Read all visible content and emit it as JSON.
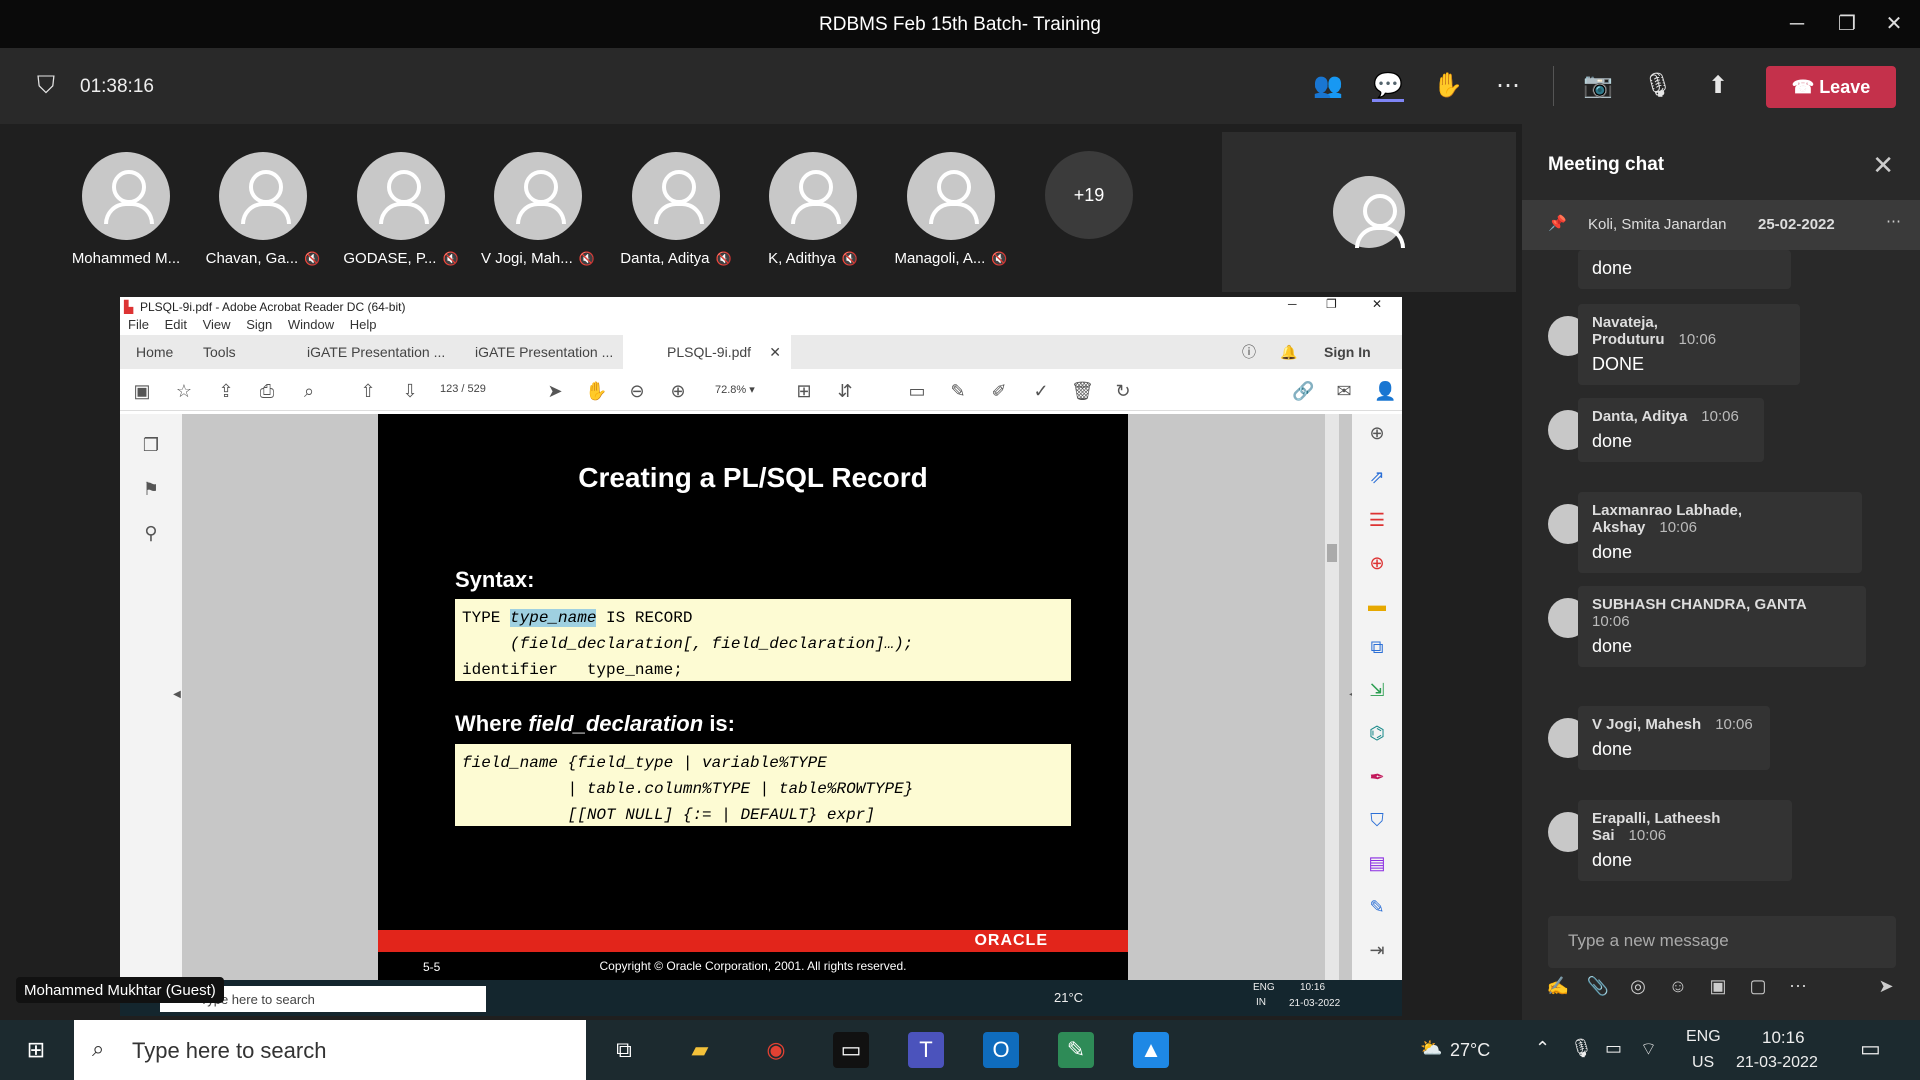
{
  "window": {
    "title": "RDBMS Feb 15th Batch- Training"
  },
  "toolbar": {
    "timer": "01:38:16",
    "leave_label": "Leave"
  },
  "participants": [
    {
      "name": "Mohammed M...",
      "muted": false
    },
    {
      "name": "Chavan, Ga...",
      "muted": true
    },
    {
      "name": "GODASE, P...",
      "muted": true
    },
    {
      "name": "V Jogi, Mah...",
      "muted": true
    },
    {
      "name": "Danta, Aditya",
      "muted": true
    },
    {
      "name": "K, Adithya",
      "muted": true
    },
    {
      "name": "Managoli, A...",
      "muted": true
    }
  ],
  "more_participants": "+19",
  "share": {
    "window_title": "PLSQL-9i.pdf - Adobe Acrobat Reader DC (64-bit)",
    "menu": [
      "File",
      "Edit",
      "View",
      "Sign",
      "Window",
      "Help"
    ],
    "tabs": {
      "home": "Home",
      "tools": "Tools",
      "doc1": "iGATE Presentation ...",
      "doc2": "iGATE Presentation ...",
      "doc3": "PLSQL-9i.pdf"
    },
    "sign_in": "Sign In",
    "page_current": "123",
    "page_total": "/ 529",
    "zoom": "72.8%",
    "slide": {
      "title": "Creating a PL/SQL Record",
      "syntax_heading": "Syntax:",
      "code1_l1a": "TYPE ",
      "code1_l1b": "type_name",
      "code1_l1c": " IS RECORD",
      "code1_l2": "     (field_declaration[, field_declaration]…);",
      "code1_l3": "identifier   type_name;",
      "where_heading_a": "Where ",
      "where_heading_b": "field_declaration",
      "where_heading_c": " is:",
      "code2": "field_name {field_type | variable%TYPE\n           | table.column%TYPE | table%ROWTYPE}\n           [[NOT NULL] {:= | DEFAULT} expr]",
      "brand": "ORACLE",
      "page_label": "5-5",
      "copyright": "Copyright © Oracle Corporation, 2001. All rights reserved."
    },
    "inner_taskbar": {
      "search": "Type here to search",
      "temp": "21°C",
      "lang1": "ENG",
      "lang2": "IN",
      "time": "10:16",
      "date": "21-03-2022"
    }
  },
  "presenter_label": "Mohammed Mukhtar (Guest)",
  "chat": {
    "title": "Meeting chat",
    "pinned": {
      "author": "Koli, Smita Janardan",
      "date": "25-02-2022"
    },
    "messages": [
      {
        "author": "",
        "time": "",
        "text": "done"
      },
      {
        "author": "Navateja, Produturu",
        "time": "10:06",
        "text": "DONE"
      },
      {
        "author": "Danta, Aditya",
        "time": "10:06",
        "text": "done"
      },
      {
        "author": "Laxmanrao Labhade, Akshay",
        "time": "10:06",
        "text": "done"
      },
      {
        "author": "SUBHASH CHANDRA, GANTA",
        "time": "10:06",
        "text": "done"
      },
      {
        "author": "V Jogi, Mahesh",
        "time": "10:06",
        "text": "done"
      },
      {
        "author": "Erapalli, Latheesh Sai",
        "time": "10:06",
        "text": "done"
      }
    ],
    "compose_placeholder": "Type a new message"
  },
  "taskbar": {
    "search": "Type here to search",
    "temp": "27°C",
    "lang1": "ENG",
    "lang2": "US",
    "time": "10:16",
    "date": "21-03-2022"
  }
}
